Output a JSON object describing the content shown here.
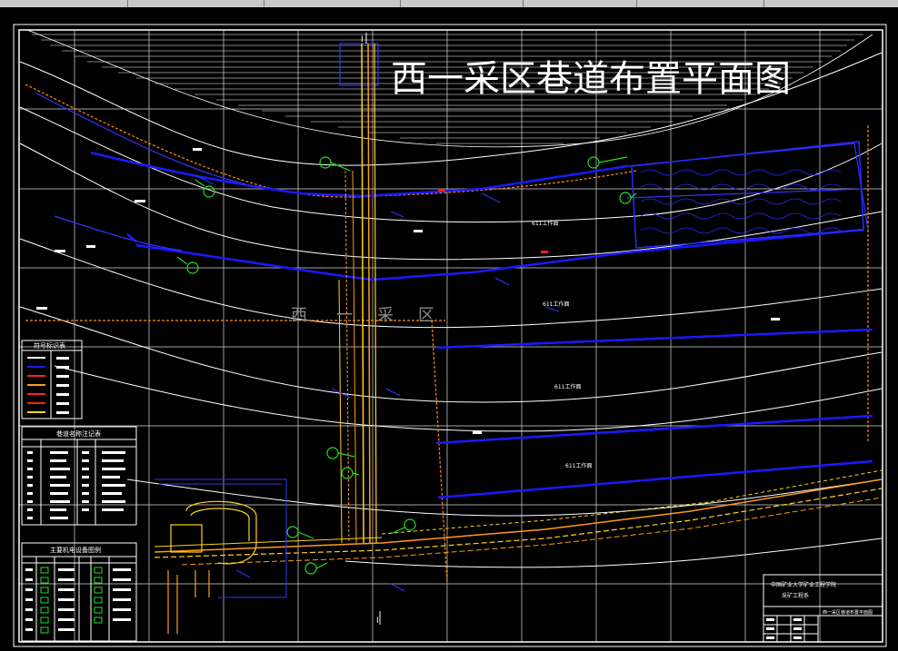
{
  "drawing": {
    "title": "西一采区巷道布置平面图",
    "area_watermark": [
      "西",
      "一",
      "采",
      "区"
    ],
    "workface_labels": [
      "611工作面",
      "611工作面",
      "611工作面",
      "611工作面"
    ],
    "symbol_table_title": "符号标识表",
    "roadway_table_title": "巷道名称注记表",
    "equipment_table_title": "主要机电设备图例",
    "title_block": {
      "org": "中国矿业大学矿业工程学院",
      "dept": "采矿工程系",
      "drawing_name": "西一采区巷道布置平面图"
    },
    "section_mark_top": "I",
    "section_mark_bottom": "I"
  },
  "colors": {
    "background": "#000000",
    "frame": "#ffffff",
    "grid": "#ffffff",
    "roadway_blue": "#1a1aff",
    "roadway_orange": "#ff9a1a",
    "roadway_yellow": "#ffd21a",
    "annotation_green": "#22e022",
    "red_marker": "#ff2020"
  }
}
